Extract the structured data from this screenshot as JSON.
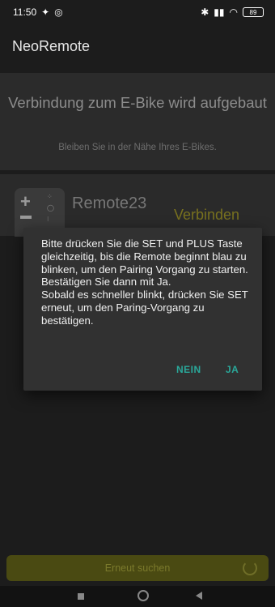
{
  "status_bar": {
    "time": "11:50",
    "battery": "89"
  },
  "app": {
    "title": "NeoRemote"
  },
  "connect": {
    "title": "Verbindung zum E-Bike wird aufgebaut",
    "subtitle": "Bleiben Sie in der Nähe Ihres E-Bikes."
  },
  "device": {
    "name": "Remote23",
    "connect_label": "Verbinden"
  },
  "dialog": {
    "message": "Bitte drücken Sie die SET und PLUS Taste gleichzeitig, bis die Remote beginnt blau zu blinken, um den Pairing Vorgang zu starten.\nBestätigen Sie dann mit Ja.\nSobald es schneller blinkt, drücken Sie SET erneut, um den Paring-Vorgang zu bestätigen.",
    "no_label": "NEIN",
    "yes_label": "JA"
  },
  "search": {
    "label": "Erneut suchen"
  },
  "colors": {
    "accent_teal": "#2aa89a",
    "accent_olive": "#78711f"
  }
}
